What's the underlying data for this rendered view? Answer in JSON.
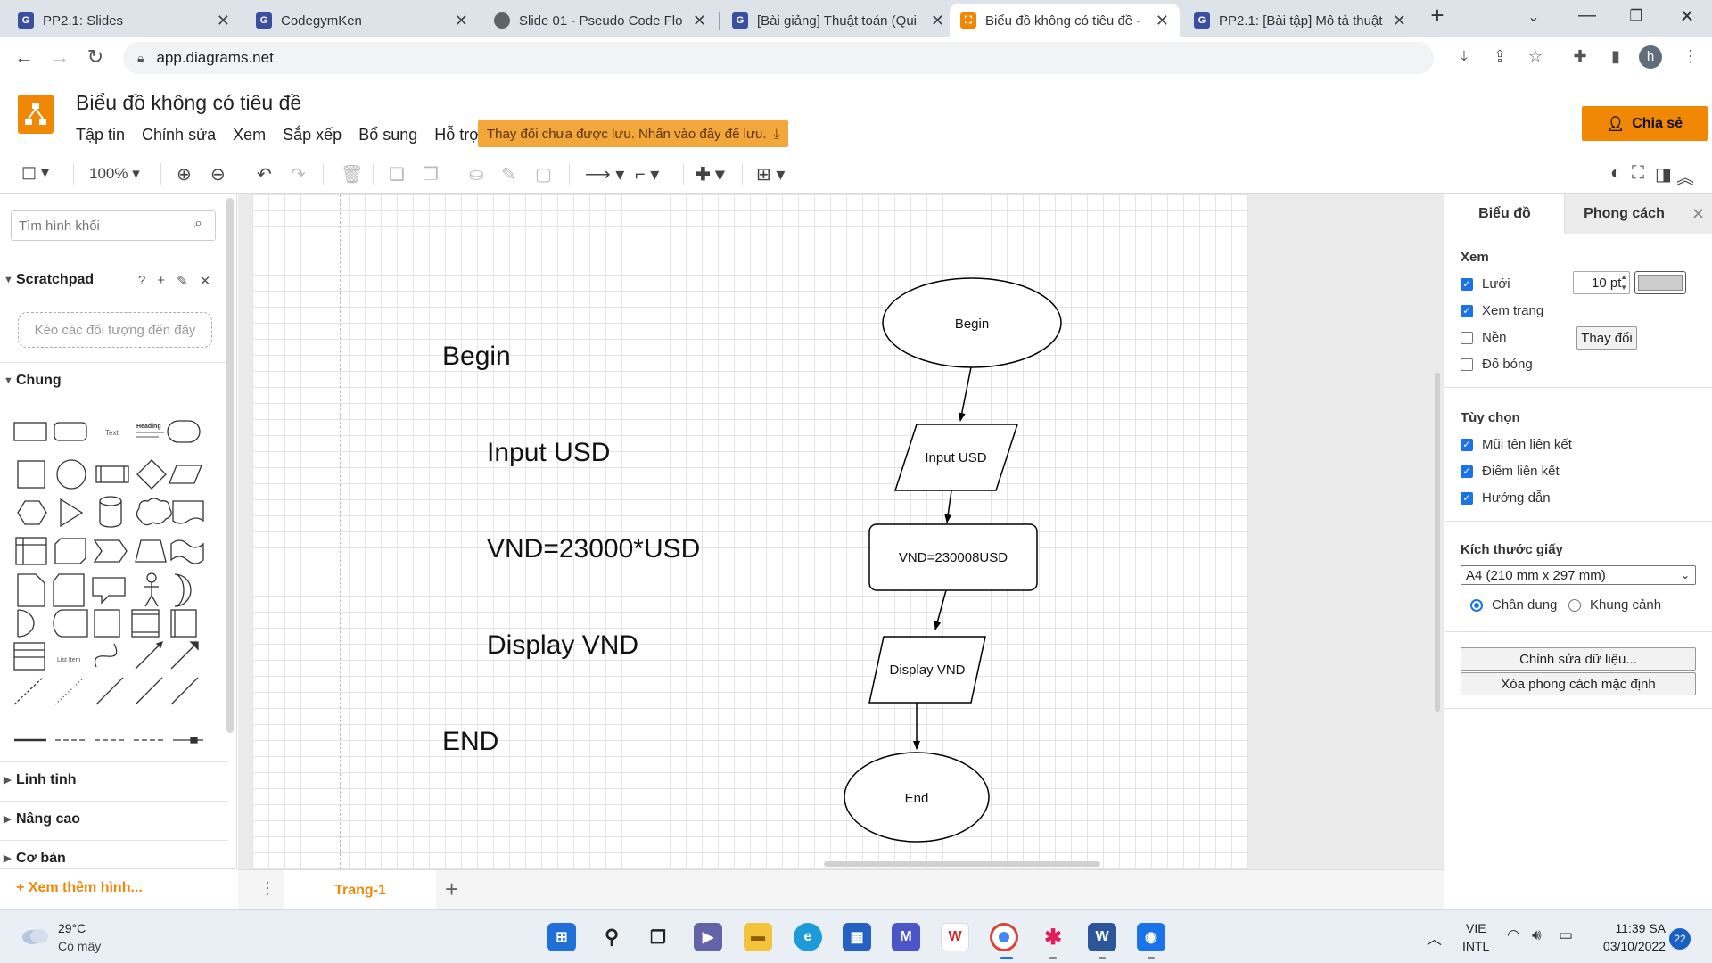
{
  "browser": {
    "tabs": [
      {
        "title": "PP2.1: Slides",
        "favicon_color": "#3b4fa0",
        "favicon_letter": "G"
      },
      {
        "title": "CodegymKen",
        "favicon_color": "#3b4fa0",
        "favicon_letter": "G"
      },
      {
        "title": "Slide 01 - Pseudo Code Flo",
        "favicon_color": "#5f6368",
        "favicon_letter": ""
      },
      {
        "title": "[Bài giảng] Thuật toán (Qui",
        "favicon_color": "#3b4fa0",
        "favicon_letter": "G"
      },
      {
        "title": "Biểu đồ không có tiêu đề -",
        "favicon_color": "#f08705",
        "favicon_letter": ""
      },
      {
        "title": "PP2.1: [Bài tập] Mô tả thuật",
        "favicon_color": "#3b4fa0",
        "favicon_letter": "G"
      }
    ],
    "url": "app.diagrams.net",
    "profile_letter": "h"
  },
  "app": {
    "title": "Biểu đồ không có tiêu đề",
    "menu": [
      "Tập tin",
      "Chỉnh sửa",
      "Xem",
      "Sắp xếp",
      "Bổ sung",
      "Hỗ trợ"
    ],
    "unsaved_notice": "Thay đổi chưa được lưu. Nhấn vào đây để lưu.",
    "share_label": "Chia sẻ",
    "accent": "#f08705"
  },
  "toolbar": {
    "zoom": "100%"
  },
  "sidebar": {
    "search_placeholder": "Tìm hình khối",
    "scratchpad_title": "Scratchpad",
    "scratchpad_help": "?",
    "scratchpad_drop": "Kéo các đối tượng đến đây",
    "general_title": "Chung",
    "shape_text_label": "Text",
    "shape_heading_label": "Heading",
    "shape_list_label": "List Item",
    "collapsed_sections": [
      "Linh tinh",
      "Nâng cao",
      "Cơ bản"
    ],
    "more_shapes": "Xem thêm hình..."
  },
  "canvas": {
    "pseudo_code": [
      "Begin",
      "      Input USD",
      "      VND=23000*USD",
      "      Display VND",
      "END"
    ],
    "flowchart": {
      "start": "Begin",
      "input": "Input USD",
      "process": "VND=230008USD",
      "output": "Display VND",
      "end": "End"
    }
  },
  "page_tabs": {
    "active": "Trang-1"
  },
  "right_panel": {
    "tab_diagram": "Biểu đồ",
    "tab_style": "Phong cách",
    "view_header": "Xem",
    "grid_label": "Lưới",
    "grid_checked": true,
    "grid_size": "10 pt",
    "grid_color": "#cccccc",
    "page_view_label": "Xem trang",
    "page_view_checked": true,
    "background_label": "Nền",
    "background_checked": false,
    "change_label": "Thay đổi",
    "shadow_label": "Đổ bóng",
    "shadow_checked": false,
    "options_header": "Tùy chọn",
    "connection_arrows_label": "Mũi tên liên kết",
    "connection_points_label": "Điểm liên kết",
    "guides_label": "Hướng dẫn",
    "paper_header": "Kích thước giấy",
    "paper_size": "A4 (210 mm x 297 mm)",
    "portrait_label": "Chân dung",
    "landscape_label": "Khung cảnh",
    "orientation": "portrait",
    "edit_data_label": "Chỉnh sửa dữ liệu...",
    "clear_style_label": "Xóa phong cách mặc định"
  },
  "taskbar": {
    "temperature": "29°C",
    "condition": "Có mây",
    "lang1": "VIE",
    "lang2": "INTL",
    "time": "11:39 SA",
    "date": "03/10/2022",
    "notifications": "22"
  }
}
